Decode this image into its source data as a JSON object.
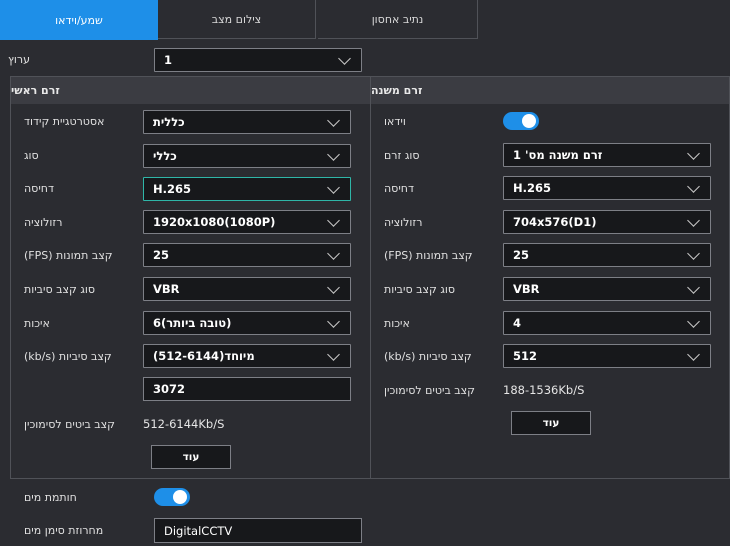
{
  "tabs": [
    {
      "label": "שמע/וידאו"
    },
    {
      "label": "צילום מצב"
    },
    {
      "label": "נתיב אחסון"
    }
  ],
  "channel": {
    "label": "ערוץ",
    "value": "1"
  },
  "main_stream": {
    "title": "זרם ראשי",
    "encoding_strategy": {
      "label": "אסטרטגיית קידוד",
      "value": "כללית"
    },
    "type": {
      "label": "סוג",
      "value": "כללי"
    },
    "compression": {
      "label": "דחיסה",
      "value": "H.265"
    },
    "resolution": {
      "label": "רזולוציה",
      "value": "1920x1080(1080P)"
    },
    "fps": {
      "label": "קצב תמונות (FPS)",
      "value": "25"
    },
    "bitrate_type": {
      "label": "סוג קצב סיביות",
      "value": "VBR"
    },
    "quality": {
      "label": "איכות",
      "value": "6(טובה ביותר)"
    },
    "bitrate": {
      "label": "קצב סיביות (kb/s)",
      "value": "מיוחד(512-6144)",
      "custom_value": "3072"
    },
    "ref_bitrate": {
      "label": "קצב ביטים לסימוכין",
      "value": "512-6144Kb/S"
    },
    "more_button": "עוד"
  },
  "sub_stream": {
    "title": "זרם משנה",
    "video": {
      "label": "וידאו",
      "enabled": true
    },
    "stream_type": {
      "label": "סוג זרם",
      "value": "זרם משנה מס' 1"
    },
    "compression": {
      "label": "דחיסה",
      "value": "H.265"
    },
    "resolution": {
      "label": "רזולוציה",
      "value": "704x576(D1)"
    },
    "fps": {
      "label": "קצב תמונות (FPS)",
      "value": "25"
    },
    "bitrate_type": {
      "label": "סוג קצב סיביות",
      "value": "VBR"
    },
    "quality": {
      "label": "איכות",
      "value": "4"
    },
    "bitrate": {
      "label": "קצב סיביות (kb/s)",
      "value": "512"
    },
    "ref_bitrate": {
      "label": "קצב ביטים לסימוכין",
      "value": "188-1536Kb/S"
    },
    "more_button": "עוד"
  },
  "watermark": {
    "label": "חותמת מים",
    "enabled": true
  },
  "watermark_text": {
    "label": "מחרוזת סימן מים",
    "value": "DigitalCCTV"
  },
  "colors": {
    "accent": "#1e8fe8",
    "background": "#2b2c31",
    "focus": "#2fb6a8"
  }
}
